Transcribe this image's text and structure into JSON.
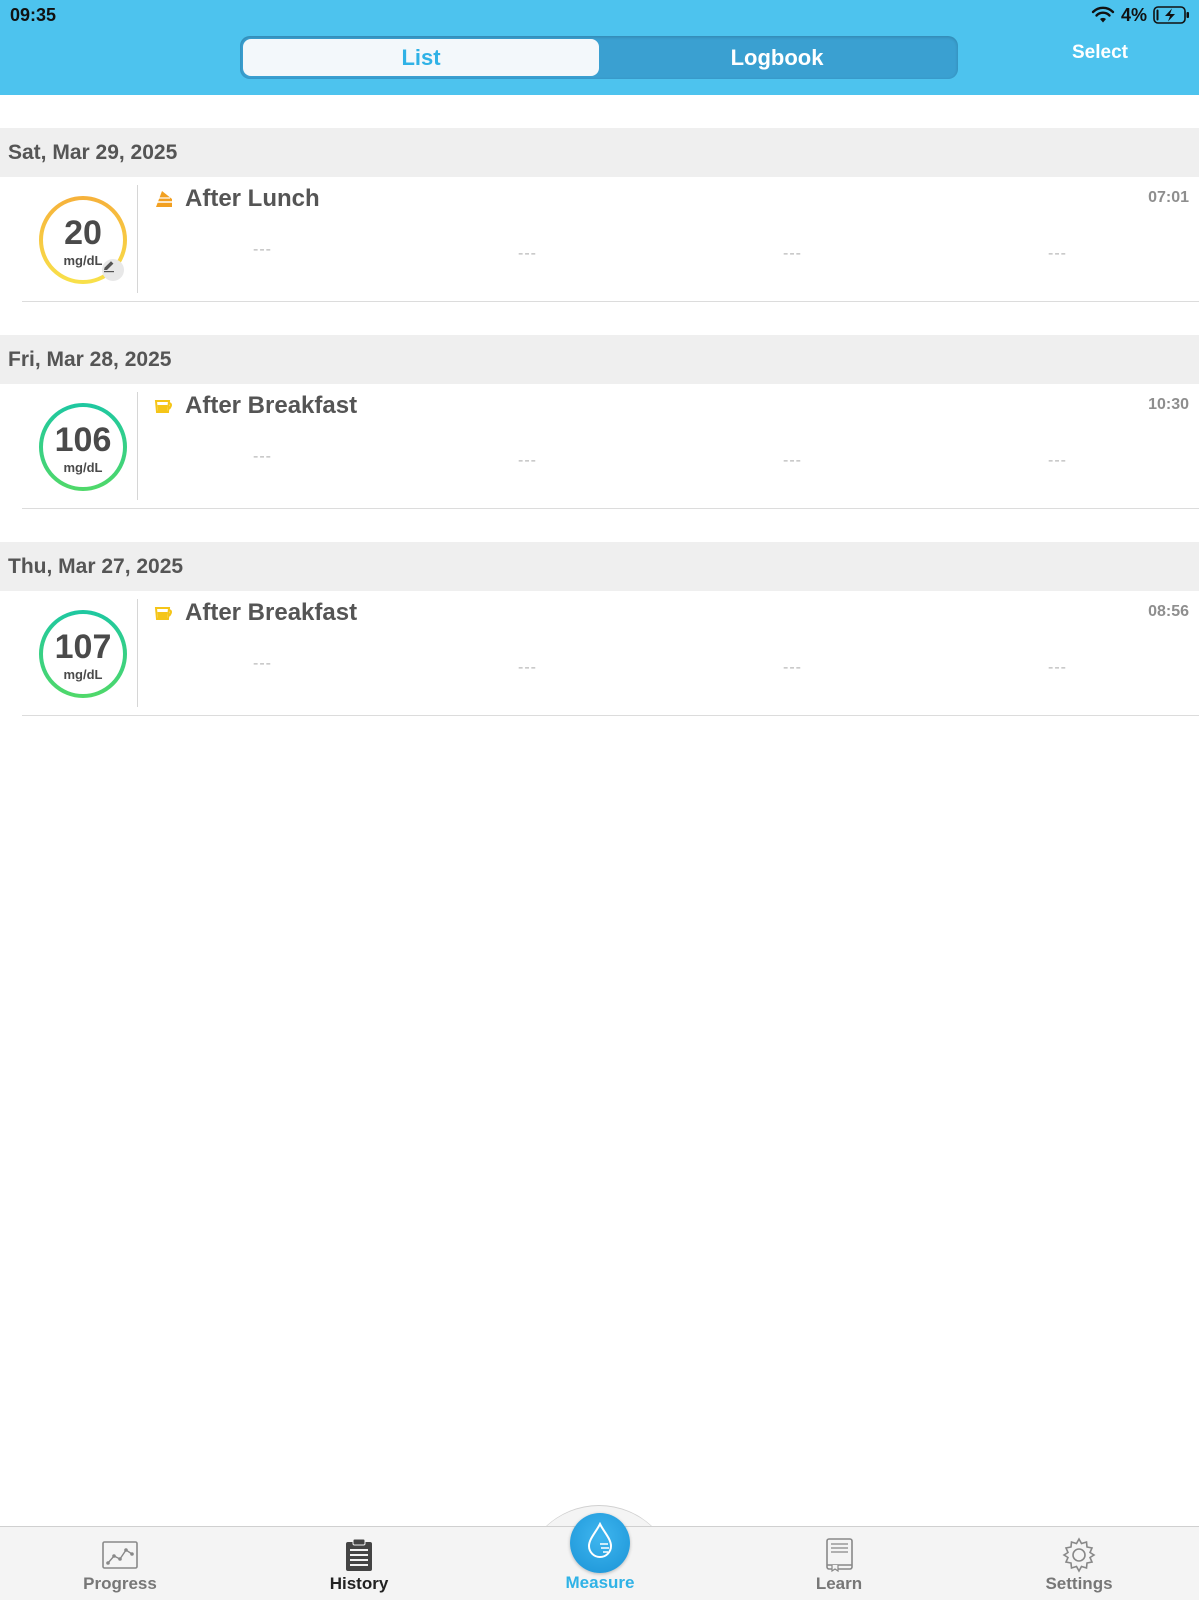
{
  "status_bar": {
    "time": "09:35",
    "battery_percent": "4%",
    "icons": [
      "wifi-icon",
      "battery-charging-icon"
    ]
  },
  "header": {
    "segments": [
      {
        "label": "List",
        "active": true
      },
      {
        "label": "Logbook",
        "active": false
      }
    ],
    "select_label": "Select"
  },
  "colors": {
    "header_bg": "#4dc3ee",
    "accent": "#2fb2e6",
    "gauge_low_start": "#f6b23b",
    "gauge_low_end": "#f8e04a",
    "gauge_normal_start": "#1fc8a0",
    "gauge_normal_end": "#4fd86a"
  },
  "sections": [
    {
      "date": "Sat, Mar 29, 2025",
      "entries": [
        {
          "value": "20",
          "unit": "mg/dL",
          "status": "low",
          "edited": true,
          "meal_icon": "meal-lunch-icon",
          "meal_label": "After Lunch",
          "time": "07:01",
          "fields": [
            "---",
            "---",
            "---",
            "---"
          ]
        }
      ]
    },
    {
      "date": "Fri, Mar 28, 2025",
      "entries": [
        {
          "value": "106",
          "unit": "mg/dL",
          "status": "normal",
          "edited": false,
          "meal_icon": "meal-breakfast-icon",
          "meal_label": "After Breakfast",
          "time": "10:30",
          "fields": [
            "---",
            "---",
            "---",
            "---"
          ]
        }
      ]
    },
    {
      "date": "Thu, Mar 27, 2025",
      "entries": [
        {
          "value": "107",
          "unit": "mg/dL",
          "status": "normal",
          "edited": false,
          "meal_icon": "meal-breakfast-icon",
          "meal_label": "After Breakfast",
          "time": "08:56",
          "fields": [
            "---",
            "---",
            "---",
            "---"
          ]
        }
      ]
    }
  ],
  "tabbar": {
    "tabs": [
      {
        "label": "Progress",
        "icon": "progress-chart-icon",
        "active": false
      },
      {
        "label": "History",
        "icon": "clipboard-list-icon",
        "active": true
      },
      {
        "label": "Measure",
        "icon": "blood-drop-icon",
        "active": false
      },
      {
        "label": "Learn",
        "icon": "book-icon",
        "active": false
      },
      {
        "label": "Settings",
        "icon": "gear-icon",
        "active": false
      }
    ]
  }
}
